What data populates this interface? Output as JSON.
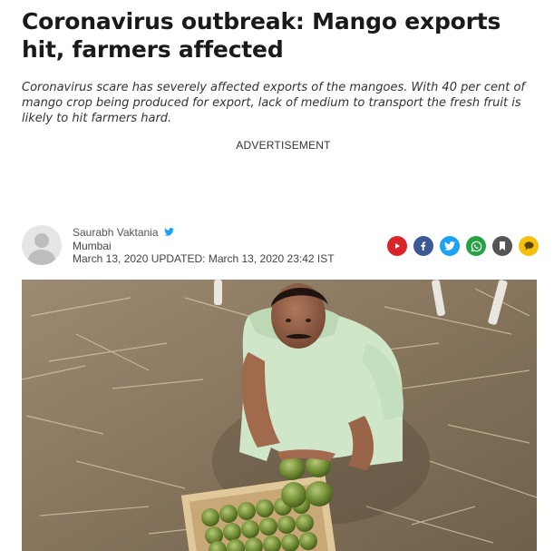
{
  "article": {
    "headline": "Coronavirus outbreak: Mango exports hit, farmers affected",
    "summary": "Coronavirus scare has severely affected exports of the mangoes. With 40 per cent of mango crop being produced for export, lack of medium to transport the fresh fruit is likely to hit farmers hard.",
    "advertisement_label": "ADVERTISEMENT"
  },
  "byline": {
    "author": "Saurabh Vaktania",
    "location": "Mumbai",
    "dates": "March 13, 2020 UPDATED: March 13, 2020 23:42 IST"
  },
  "share_buttons": [
    {
      "name": "youtube",
      "color": "#d9252a"
    },
    {
      "name": "facebook",
      "color": "#3b5998"
    },
    {
      "name": "twitter",
      "color": "#1da1f2"
    },
    {
      "name": "whatsapp",
      "color": "#25a244"
    },
    {
      "name": "bookmark",
      "color": "#555555"
    },
    {
      "name": "comment",
      "color": "#f4c20d"
    }
  ]
}
